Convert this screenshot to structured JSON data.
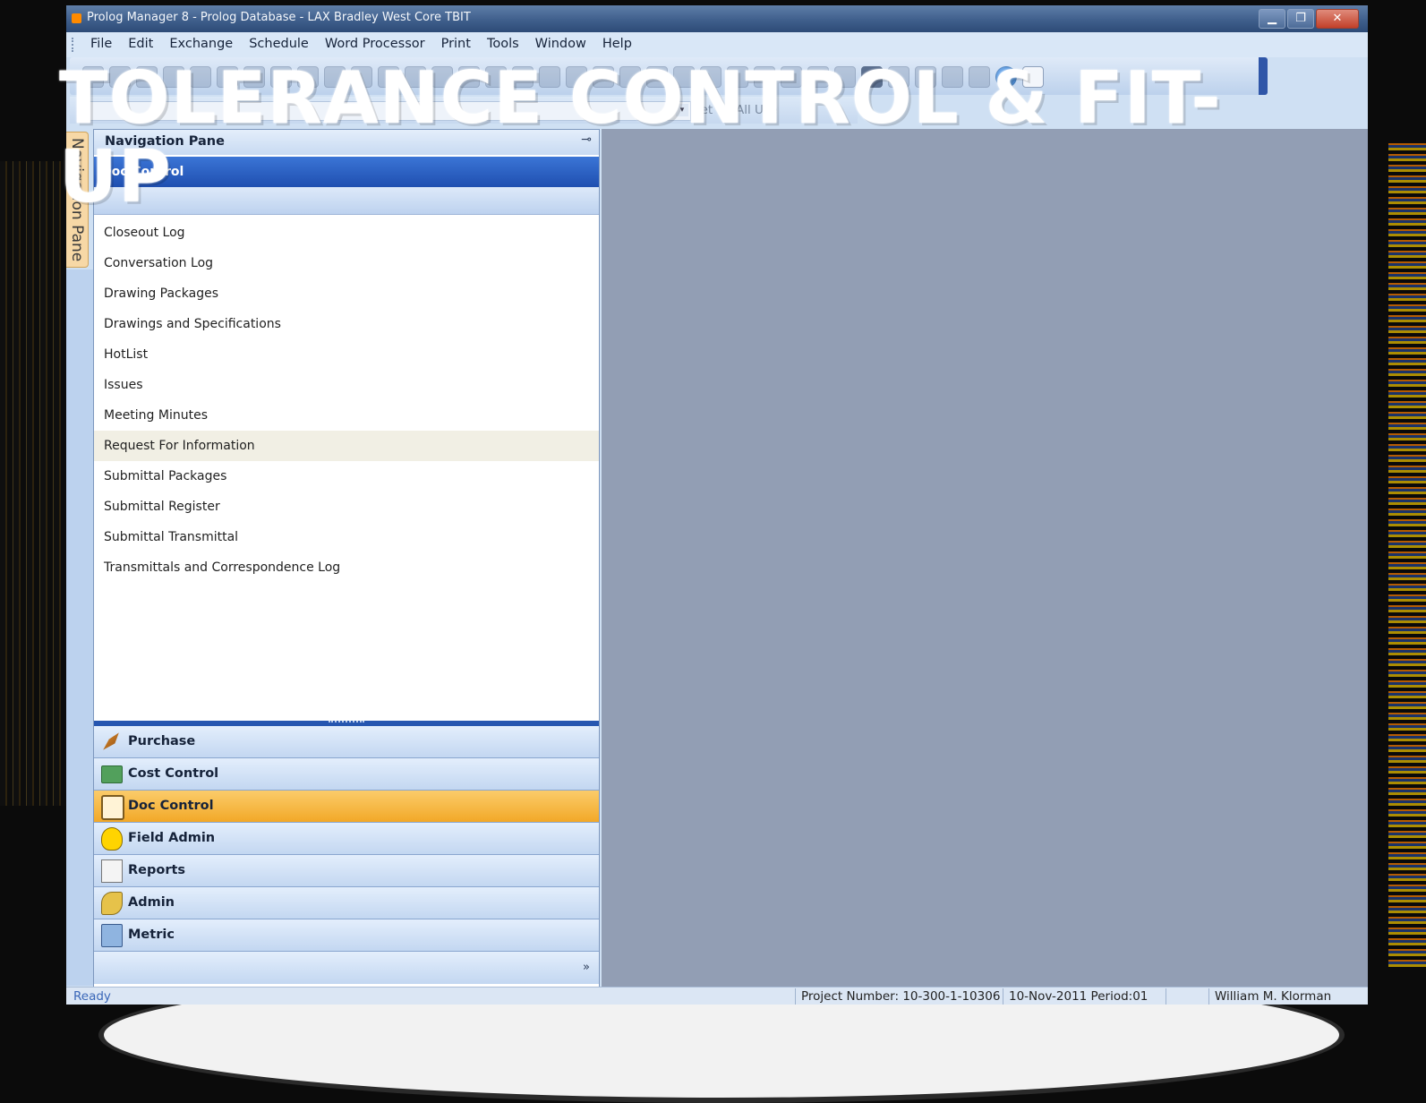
{
  "window": {
    "title": "Prolog Manager 8 - Prolog Database - LAX Bradley West Core TBIT",
    "controls": {
      "minimize": "▁",
      "restore": "❐",
      "close": "✕"
    }
  },
  "menu": [
    "File",
    "Edit",
    "Exchange",
    "Schedule",
    "Word Processor",
    "Print",
    "Tools",
    "Window",
    "Help"
  ],
  "toolbar2": {
    "set_label": "Set",
    "users_label": "All Use"
  },
  "side_tab": {
    "label": "Navigation Pane"
  },
  "nav_pane": {
    "title": "Navigation Pane",
    "pin_icon": "pin-icon",
    "group_title": "Doc Control",
    "items": [
      "Closeout Log",
      "Conversation Log",
      "Drawing Packages",
      "Drawings and Specifications",
      "HotList",
      "Issues",
      "Meeting Minutes",
      "Request For Information",
      "Submittal Packages",
      "Submittal Register",
      "Submittal Transmittal",
      "Transmittals and Correspondence Log"
    ],
    "hovered_item": "Request For Information",
    "sections": [
      {
        "label": "Purchase",
        "icon": "hammer-icon"
      },
      {
        "label": "Cost Control",
        "icon": "ledger-icon"
      },
      {
        "label": "Doc Control",
        "icon": "document-icon",
        "active": true
      },
      {
        "label": "Field Admin",
        "icon": "hardhat-icon"
      },
      {
        "label": "Reports",
        "icon": "report-icon"
      },
      {
        "label": "Admin",
        "icon": "key-icon"
      },
      {
        "label": "Metric",
        "icon": "books-icon"
      }
    ]
  },
  "status": {
    "ready": "Ready",
    "project": "Project Number: 10-300-1-10306",
    "date_period": "10-Nov-2011  Period:01",
    "user": "William M. Klorman"
  },
  "overlay_text": "TOLERANCE CONTROL & FIT-UP",
  "colors": {
    "active_section": "#f2a828",
    "group_header": "#1f4fb0",
    "workspace": "#929eb4"
  }
}
